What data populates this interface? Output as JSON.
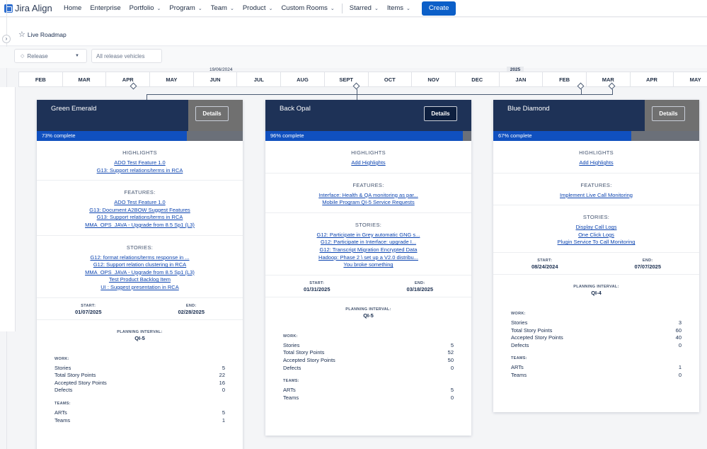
{
  "nav": {
    "logo": "Jira Align",
    "items": [
      {
        "label": "Home",
        "dropdown": false
      },
      {
        "label": "Enterprise",
        "dropdown": false
      },
      {
        "label": "Portfolio",
        "dropdown": true
      },
      {
        "label": "Program",
        "dropdown": true
      },
      {
        "label": "Team",
        "dropdown": true
      },
      {
        "label": "Product",
        "dropdown": true
      },
      {
        "label": "Custom Rooms",
        "dropdown": true
      }
    ],
    "right_items": [
      {
        "label": "Starred",
        "dropdown": true
      },
      {
        "label": "Items",
        "dropdown": true
      }
    ],
    "create": "Create",
    "caret_glyph": "⌄"
  },
  "page": {
    "title": "Live Roadmap",
    "expand_glyph": "›"
  },
  "filters": {
    "release_label": "Release",
    "vehicles_placeholder": "All release vehicles"
  },
  "timeline": {
    "months": [
      "FEB",
      "MAR",
      "APR",
      "MAY",
      "JUN",
      "JUL",
      "AUG",
      "SEPT",
      "OCT",
      "NOV",
      "DEC",
      "JAN",
      "FEB",
      "MAR",
      "APR",
      "MAY"
    ],
    "today_label": "19/06/2024",
    "year_label": "2025"
  },
  "colors": {
    "header": "#1e3257",
    "progress": "#1050bf",
    "link": "#0c44b0",
    "accent": "#0c5fc8"
  },
  "cards": [
    {
      "name": "Green Emerald",
      "details": "Details",
      "progress_pct": 73,
      "progress_text": "73% complete",
      "highlights_title": "HIGHLIGHTS",
      "highlights": [
        "ADO Test Feature 1.0",
        "G13: Support relations/terms in RCA"
      ],
      "features_title": "FEATURES:",
      "features": [
        "ADO Test Feature 1.0",
        "G13: Document A2BOW Suggest Features",
        "G13: Support relations/terms in RCA",
        "MMA_OPS_JAVA - Upgrade from 8.5 Sp1 (L3)"
      ],
      "stories_title": "STORIES:",
      "stories": [
        "G12: format relations/terms response in ...",
        "G12: Support relation clustering in RCA",
        "MMA_OPS_JAVA - Upgrade from 8.5 Sp1 (L3)",
        "Test Product Backlog Item",
        "UI : Suggest presentation in RCA"
      ],
      "start_label": "START:",
      "start": "01/07/2025",
      "end_label": "END:",
      "end": "02/28/2025",
      "pi_label": "PLANNING INTERVAL:",
      "pi": "QI-5",
      "work_title": "WORK:",
      "work": [
        {
          "label": "Stories",
          "value": "5"
        },
        {
          "label": "Total Story Points",
          "value": "22"
        },
        {
          "label": "Accepted Story Points",
          "value": "16"
        },
        {
          "label": "Defects",
          "value": "0"
        }
      ],
      "teams_title": "TEAMS:",
      "teams": [
        {
          "label": "ARTs",
          "value": "5"
        },
        {
          "label": "Teams",
          "value": "1"
        }
      ]
    },
    {
      "name": "Back Opal",
      "details": "Details",
      "progress_pct": 96,
      "progress_text": "96% complete",
      "highlights_title": "HIGHLIGHTS",
      "highlights": [
        "Add Highlights"
      ],
      "features_title": "FEATURES:",
      "features": [
        "Interface: Health & QA monitoring as par...",
        "Mobile Program QI-5 Service Requests"
      ],
      "stories_title": "STORIES:",
      "stories": [
        "G12: Participate in Grey automatic GNG s...",
        "G12: Participate in Interface: upgrade I...",
        "G12: Transcript Migration Encrypted Data",
        "Hadoop: Phase 2 \\ set up a V2.0 distribu...",
        "You broke something"
      ],
      "start_label": "START:",
      "start": "01/31/2025",
      "end_label": "END:",
      "end": "03/18/2025",
      "pi_label": "PLANNING INTERVAL:",
      "pi": "QI-5",
      "work_title": "WORK:",
      "work": [
        {
          "label": "Stories",
          "value": "5"
        },
        {
          "label": "Total Story Points",
          "value": "52"
        },
        {
          "label": "Accepted Story Points",
          "value": "50"
        },
        {
          "label": "Defects",
          "value": "0"
        }
      ],
      "teams_title": "TEAMS:",
      "teams": [
        {
          "label": "ARTs",
          "value": "5"
        },
        {
          "label": "Teams",
          "value": "0"
        }
      ]
    },
    {
      "name": "Blue Diamond",
      "details": "Details",
      "progress_pct": 67,
      "progress_text": "67% complete",
      "highlights_title": "HIGHLIGHTS",
      "highlights": [
        "Add Highlights"
      ],
      "features_title": "FEATURES:",
      "features": [
        "Implement Live Call Monitoring"
      ],
      "stories_title": "STORIES:",
      "stories": [
        "Display Call Logs",
        "One Click Logs",
        "Plugin Service To Call Monitoring"
      ],
      "start_label": "START:",
      "start": "08/24/2024",
      "end_label": "END:",
      "end": "07/07/2025",
      "pi_label": "PLANNING INTERVAL:",
      "pi": "QI-4",
      "work_title": "WORK:",
      "work": [
        {
          "label": "Stories",
          "value": "3"
        },
        {
          "label": "Total Story Points",
          "value": "60"
        },
        {
          "label": "Accepted Story Points",
          "value": "40"
        },
        {
          "label": "Defects",
          "value": "0"
        }
      ],
      "teams_title": "TEAMS:",
      "teams": [
        {
          "label": "ARTs",
          "value": "1"
        },
        {
          "label": "Teams",
          "value": "0"
        }
      ]
    }
  ]
}
